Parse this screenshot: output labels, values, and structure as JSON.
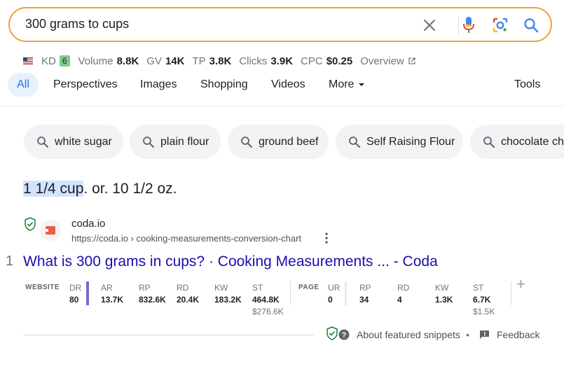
{
  "search": {
    "query": "300 grams to cups"
  },
  "toolbar": {
    "kd_label": "KD",
    "kd_value": "6",
    "volume_label": "Volume",
    "volume_value": "8.8K",
    "gv_label": "GV",
    "gv_value": "14K",
    "tp_label": "TP",
    "tp_value": "3.8K",
    "clicks_label": "Clicks",
    "clicks_value": "3.9K",
    "cpc_label": "CPC",
    "cpc_value": "$0.25",
    "overview_label": "Overview",
    "kd_color": "#7ecb8a"
  },
  "tabs": {
    "all": "All",
    "perspectives": "Perspectives",
    "images": "Images",
    "shopping": "Shopping",
    "videos": "Videos",
    "more": "More",
    "tools": "Tools"
  },
  "chips": [
    "white sugar",
    "plain flour",
    "ground beef",
    "Self Raising Flour",
    "chocolate chi"
  ],
  "answer": {
    "highlight": "1 1/4 cup",
    "rest": ". or. 10 1/2 oz."
  },
  "result": {
    "number": "1",
    "site_name": "coda.io",
    "url": "https://coda.io › cooking-measurements-conversion-chart",
    "title": "What is 300 grams in cups? · Cooking Measurements ... - Coda",
    "website_section": "WEBSITE",
    "page_section": "PAGE",
    "website_metrics": {
      "dr_label": "DR",
      "dr_value": "80",
      "ar_label": "AR",
      "ar_value": "13.7K",
      "rp_label": "RP",
      "rp_value": "832.6K",
      "rd_label": "RD",
      "rd_value": "20.4K",
      "kw_label": "KW",
      "kw_value": "183.2K",
      "st_label": "ST",
      "st_value": "464.8K",
      "st_sub": "$276.6K"
    },
    "page_metrics": {
      "ur_label": "UR",
      "ur_value": "0",
      "rp_label": "RP",
      "rp_value": "34",
      "rd_label": "RD",
      "rd_value": "4",
      "kw_label": "KW",
      "kw_value": "1.3K",
      "st_label": "ST",
      "st_value": "6.7K",
      "st_sub": "$1.5K"
    }
  },
  "footer": {
    "about": "About featured snippets",
    "separator": "•",
    "feedback": "Feedback"
  },
  "colors": {
    "search_border": "#f0a030",
    "link": "#1a0dab",
    "tab_active": "#1a73e8",
    "dr_bar": "#7b68c9"
  }
}
